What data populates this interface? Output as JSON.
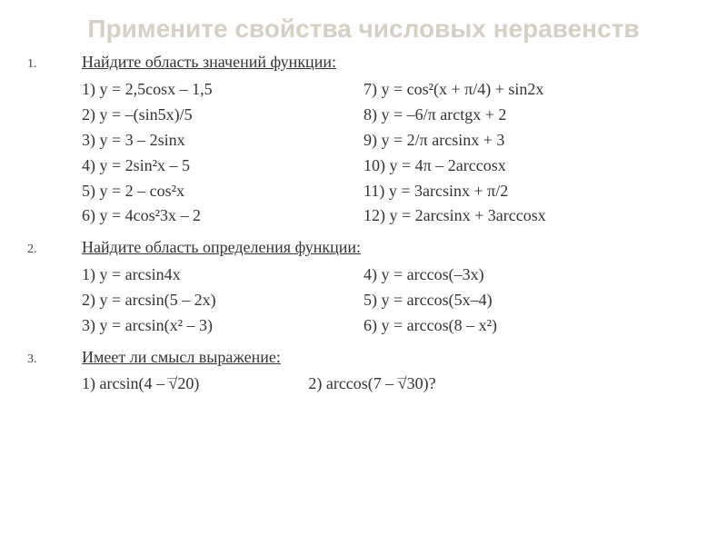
{
  "title": "Примените свойства числовых неравенств",
  "sections": [
    {
      "num": "1.",
      "heading": "Найдите область значений функции:",
      "left": [
        "1)   у = 2,5соsх – 1,5",
        "2)   у = –(sin5х)/5",
        "3)   у = 3 – 2sinх",
        "4)   у = 2sin²х – 5",
        "5)   у = 2 – cos²х",
        "6)   у = 4cos²3х – 2"
      ],
      "right": [
        "  7)   у = cos²(х + π/4) + sin2х",
        "  8)   у = –6/π arctgх + 2",
        "  9)   у = 2/π arcsinх + 3",
        "10)   у = 4π – 2arccosх",
        "11)   у = 3arcsinх + π/2",
        "12)   у = 2arcsinх + 3arccosх"
      ]
    },
    {
      "num": "2.",
      "heading": "Найдите область определения функции:",
      "left": [
        " 1)  у = arcsin4х",
        " 2)  у = arcsin(5 – 2х)",
        " 3)  у = arcsin(х² – 3)"
      ],
      "right": [
        " 4)   у = arccos(–3х)",
        " 5)   у = arccos(5х–4)",
        "6)    у = arccos(8 – х²)"
      ]
    },
    {
      "num": "3.",
      "heading": "Имеет ли смысл выражение:",
      "items": [
        {
          "over": "__",
          "text": " 1)   arcsin(4 – √20)"
        },
        {
          "over": "__",
          "text": "2)    arccos(7 – √30)?"
        }
      ]
    }
  ]
}
